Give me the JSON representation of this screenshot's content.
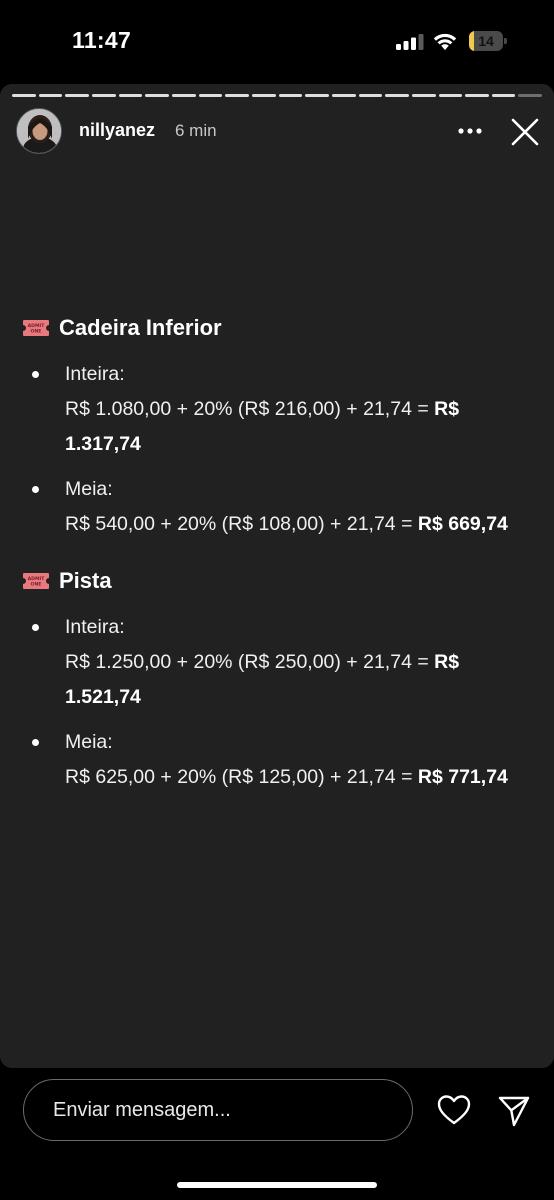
{
  "status_bar": {
    "time": "11:47",
    "battery_level": "14",
    "battery_color": "#f2c94c"
  },
  "story": {
    "progress_segments": 20,
    "progress_current": 19,
    "username": "nillyanez",
    "time_ago": "6 min",
    "icons": {
      "more": "more-horizontal-icon",
      "close": "close-icon",
      "section": "admit-one-ticket-icon"
    },
    "sections": [
      {
        "title": "Cadeira Inferior",
        "items": [
          {
            "label": "Inteira:",
            "formula": "R$ 1.080,00 + 20% (R$ 216,00) + 21,74 = ",
            "total": "R$ 1.317,74"
          },
          {
            "label": "Meia:",
            "formula": "R$ 540,00 + 20% (R$ 108,00) + 21,74 = ",
            "total": "R$ 669,74"
          }
        ]
      },
      {
        "title": "Pista",
        "items": [
          {
            "label": "Inteira:",
            "formula": "R$ 1.250,00 + 20% (R$ 250,00) + 21,74 = ",
            "total": "R$ 1.521,74"
          },
          {
            "label": "Meia:",
            "formula": "R$ 625,00 + 20% (R$ 125,00) + 21,74 = ",
            "total": "R$ 771,74"
          }
        ]
      }
    ]
  },
  "reply": {
    "placeholder": "Enviar mensagem...",
    "icons": {
      "like": "heart-icon",
      "share": "send-icon"
    }
  }
}
